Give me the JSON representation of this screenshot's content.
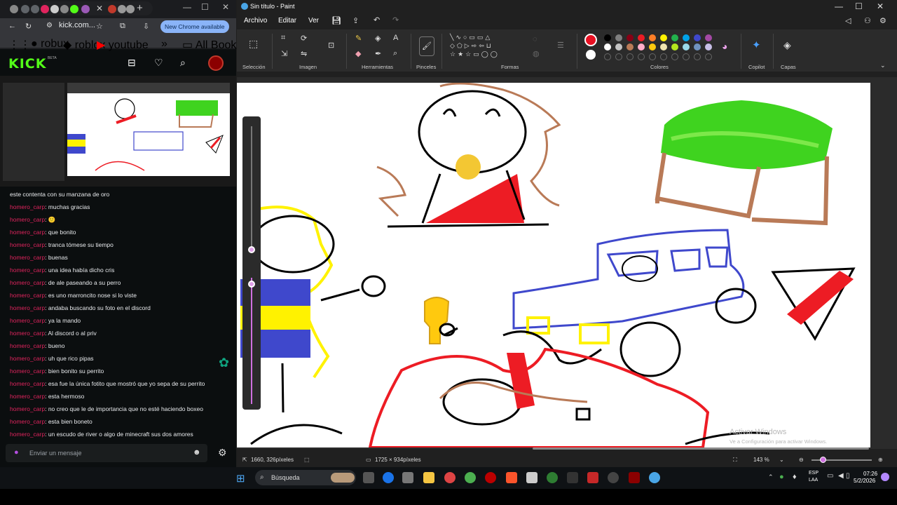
{
  "browser": {
    "address": "kick.com...",
    "new_chrome": "New Chrome available",
    "bookmarks": [
      "robux",
      "roblox",
      "youtube"
    ],
    "all_bookmarks": "All Bookmarks"
  },
  "kick": {
    "logo": "KICK",
    "beta": "BETA"
  },
  "chat": {
    "messages": [
      {
        "user": "",
        "text": "este contenta con su manzana de oro"
      },
      {
        "user": "homero_carp",
        "text": ": muchas gracias"
      },
      {
        "user": "homero_carp",
        "text": ": 🙂"
      },
      {
        "user": "homero_carp",
        "text": ": que bonito"
      },
      {
        "user": "homero_carp",
        "text": ": tranca tómese su tiempo"
      },
      {
        "user": "homero_carp",
        "text": ": buenas"
      },
      {
        "user": "homero_carp",
        "text": ": una idea había dicho cris"
      },
      {
        "user": "homero_carp",
        "text": ": de ale paseando a su perro"
      },
      {
        "user": "homero_carp",
        "text": ": es uno marroncito nose si lo viste"
      },
      {
        "user": "homero_carp",
        "text": ": andaba buscando su foto en el discord"
      },
      {
        "user": "homero_carp",
        "text": ": ya la mando"
      },
      {
        "user": "homero_carp",
        "text": ": Al discord o al priv"
      },
      {
        "user": "homero_carp",
        "text": ": bueno"
      },
      {
        "user": "homero_carp",
        "text": ": uh que rico pipas"
      },
      {
        "user": "homero_carp",
        "text": ": bien bonito su perrito"
      },
      {
        "user": "homero_carp",
        "text": ": esa fue la única fotito que mostró que yo sepa de su perrito"
      },
      {
        "user": "homero_carp",
        "text": ": esta hermoso"
      },
      {
        "user": "homero_carp",
        "text": ": no creo que le de importancia que no esté haciendo boxeo"
      },
      {
        "user": "homero_carp",
        "text": ": esta bien boneto"
      },
      {
        "user": "homero_carp",
        "text": ": un escudo de river o algo de minecraft sus dos amores"
      }
    ],
    "input_placeholder": "Enviar un mensaje"
  },
  "paint": {
    "title": "Sin título - Paint",
    "menu": [
      "Archivo",
      "Editar",
      "Ver"
    ],
    "groups": [
      "Selección",
      "Imagen",
      "Herramientas",
      "Pinceles",
      "Formas",
      "Colores",
      "Copilot",
      "Capas"
    ],
    "status_cursor": "1660, 326píxeles",
    "status_size": "1725 × 934píxeles",
    "zoom": "143 %",
    "watermark_title": "Activar Windows",
    "watermark_sub": "Ve a Configuración para activar Windows.",
    "selected_color": "#e81123",
    "palette_row1": [
      "#000000",
      "#7f7f7f",
      "#880015",
      "#ed1c24",
      "#ff7f27",
      "#fff200",
      "#22b14c",
      "#00a2e8",
      "#3f48cc",
      "#a349a4"
    ],
    "palette_row2": [
      "#ffffff",
      "#c3c3c3",
      "#b97a57",
      "#ffaec9",
      "#ffc90e",
      "#efe4b0",
      "#b5e61d",
      "#99d9ea",
      "#7092be",
      "#c8bfe7"
    ]
  },
  "taskbar": {
    "search": "Búsqueda",
    "lang1": "ESP",
    "lang2": "LAA",
    "time": "07:26",
    "date": "5/2/2026"
  }
}
